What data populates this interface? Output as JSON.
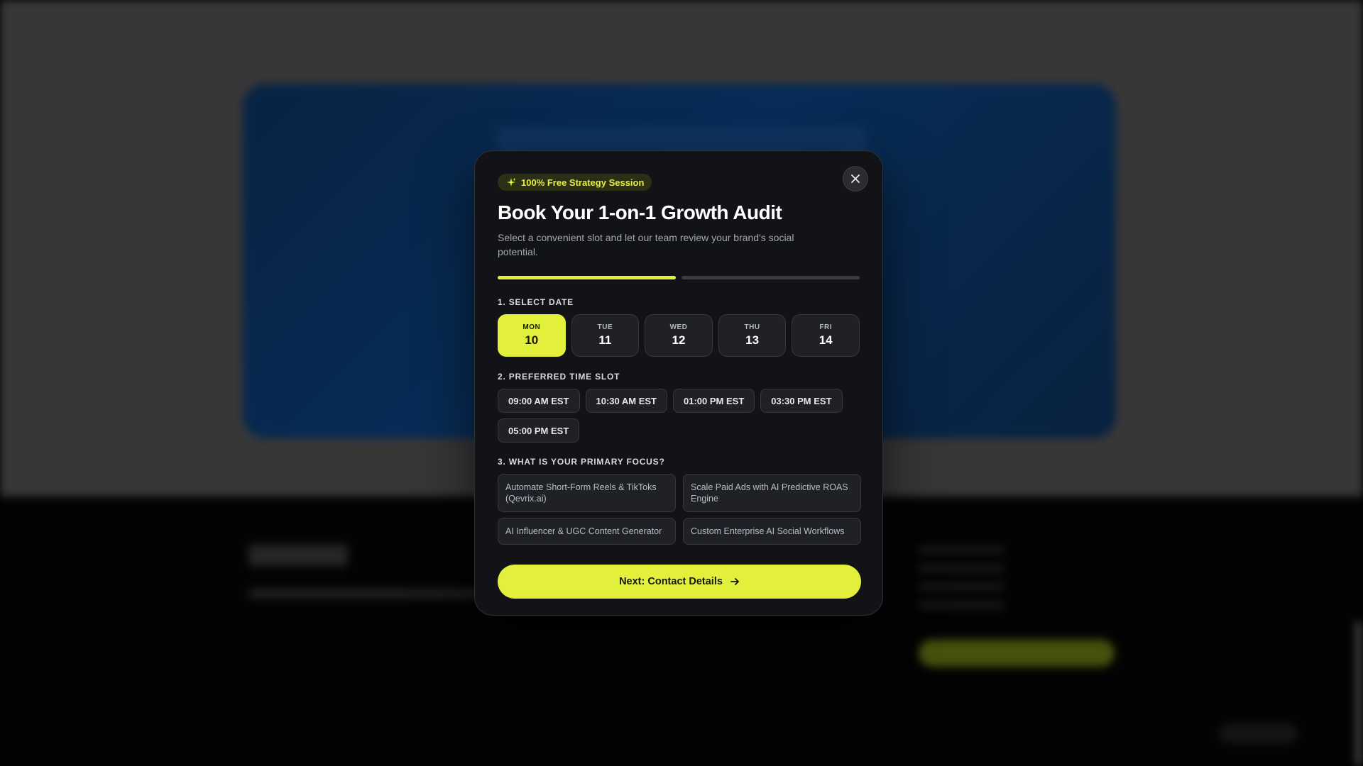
{
  "modal": {
    "badge": "100% Free Strategy Session",
    "title": "Book Your 1-on-1 Growth Audit",
    "subtitle": "Select a convenient slot and let our team review your brand's social potential.",
    "progress": {
      "current_step": 1,
      "total_steps": 2
    },
    "date_section": {
      "label": "1. SELECT DATE",
      "dates": [
        {
          "dow": "MON",
          "day": "10",
          "selected": true
        },
        {
          "dow": "TUE",
          "day": "11",
          "selected": false
        },
        {
          "dow": "WED",
          "day": "12",
          "selected": false
        },
        {
          "dow": "THU",
          "day": "13",
          "selected": false
        },
        {
          "dow": "FRI",
          "day": "14",
          "selected": false
        }
      ]
    },
    "time_section": {
      "label": "2. PREFERRED TIME SLOT",
      "slots": [
        "09:00 AM EST",
        "10:30 AM EST",
        "01:00 PM EST",
        "03:30 PM EST",
        "05:00 PM EST"
      ]
    },
    "focus_section": {
      "label": "3. WHAT IS YOUR PRIMARY FOCUS?",
      "options": [
        "Automate Short-Form Reels & TikToks (Qevrix.ai)",
        "Scale Paid Ads with AI Predictive ROAS Engine",
        "AI Influencer & UGC Content Generator",
        "Custom Enterprise AI Social Workflows"
      ]
    },
    "next_button": "Next: Contact Details",
    "icons": {
      "badge": "sparkles-icon",
      "close": "close-icon",
      "next": "arrow-right-icon"
    }
  },
  "colors": {
    "accent": "#e2f03b",
    "modal_bg": "#121316",
    "chip_bg": "#1f2126"
  }
}
